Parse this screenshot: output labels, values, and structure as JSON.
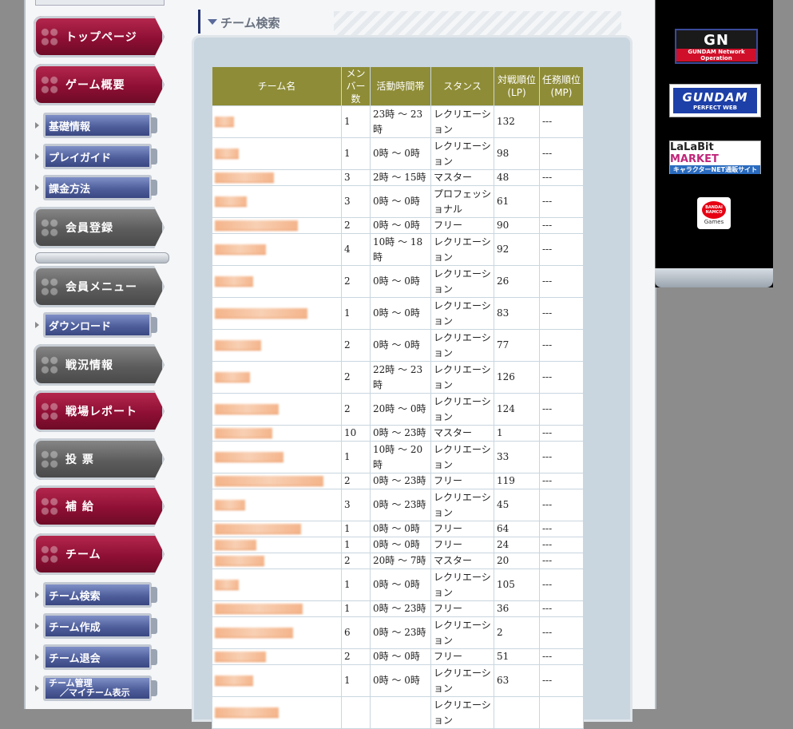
{
  "sidebar": {
    "main_items": [
      {
        "label": "トップページ",
        "style": "red"
      },
      {
        "label": "ゲーム概要",
        "style": "red"
      },
      {
        "label": "会員登録",
        "style": "gray"
      },
      {
        "label": "会員メニュー",
        "style": "gray"
      },
      {
        "label": "戦況情報",
        "style": "gray"
      },
      {
        "label": "戦場レポート",
        "style": "red"
      },
      {
        "label": "投 票",
        "style": "gray"
      },
      {
        "label": "補 給",
        "style": "red"
      },
      {
        "label": "チーム",
        "style": "red"
      }
    ],
    "sub_items": {
      "game_overview": [
        "基礎情報",
        "プレイガイド",
        "課金方法"
      ],
      "member_menu": [
        "ダウンロード"
      ],
      "team": [
        "チーム検索",
        "チーム作成",
        "チーム退会"
      ],
      "team_manage_line1": "チーム管理",
      "team_manage_line2": "／マイチーム表示"
    }
  },
  "header": {
    "title": "チーム検索"
  },
  "table": {
    "columns": {
      "name": "チーム名",
      "members": "メンバー数",
      "active_time": "活動時間帯",
      "stance": "スタンス",
      "lp_line1": "対戦順位",
      "lp_line2": "(LP)",
      "mp_line1": "任務順位",
      "mp_line2": "(MP)"
    },
    "rows": [
      {
        "members": "1",
        "time": "23時 〜 23時",
        "stance": "レクリエーション",
        "lp": "132",
        "mp": "---"
      },
      {
        "members": "1",
        "time": "0時 〜 0時",
        "stance": "レクリエーション",
        "lp": "98",
        "mp": "---"
      },
      {
        "members": "3",
        "time": "2時 〜 15時",
        "stance": "マスター",
        "lp": "48",
        "mp": "---"
      },
      {
        "members": "3",
        "time": "0時 〜 0時",
        "stance": "プロフェッショナル",
        "lp": "61",
        "mp": "---"
      },
      {
        "members": "2",
        "time": "0時 〜 0時",
        "stance": "フリー",
        "lp": "90",
        "mp": "---"
      },
      {
        "members": "4",
        "time": "10時 〜 18時",
        "stance": "レクリエーション",
        "lp": "92",
        "mp": "---"
      },
      {
        "members": "2",
        "time": "0時 〜 0時",
        "stance": "レクリエーション",
        "lp": "26",
        "mp": "---"
      },
      {
        "members": "1",
        "time": "0時 〜 0時",
        "stance": "レクリエーション",
        "lp": "83",
        "mp": "---"
      },
      {
        "members": "2",
        "time": "0時 〜 0時",
        "stance": "レクリエーション",
        "lp": "77",
        "mp": "---"
      },
      {
        "members": "2",
        "time": "22時 〜 23時",
        "stance": "レクリエーション",
        "lp": "126",
        "mp": "---"
      },
      {
        "members": "2",
        "time": "20時 〜 0時",
        "stance": "レクリエーション",
        "lp": "124",
        "mp": "---"
      },
      {
        "members": "10",
        "time": "0時 〜 23時",
        "stance": "マスター",
        "lp": "1",
        "mp": "---"
      },
      {
        "members": "1",
        "time": "10時 〜 20時",
        "stance": "レクリエーション",
        "lp": "33",
        "mp": "---"
      },
      {
        "members": "2",
        "time": "0時 〜 23時",
        "stance": "フリー",
        "lp": "119",
        "mp": "---"
      },
      {
        "members": "3",
        "time": "0時 〜 23時",
        "stance": "レクリエーション",
        "lp": "45",
        "mp": "---"
      },
      {
        "members": "1",
        "time": "0時 〜 0時",
        "stance": "フリー",
        "lp": "64",
        "mp": "---"
      },
      {
        "members": "1",
        "time": "0時 〜 0時",
        "stance": "フリー",
        "lp": "24",
        "mp": "---"
      },
      {
        "members": "2",
        "time": "20時 〜 7時",
        "stance": "マスター",
        "lp": "20",
        "mp": "---"
      },
      {
        "members": "1",
        "time": "0時 〜 0時",
        "stance": "レクリエーション",
        "lp": "105",
        "mp": "---"
      },
      {
        "members": "1",
        "time": "0時 〜 23時",
        "stance": "フリー",
        "lp": "36",
        "mp": "---"
      },
      {
        "members": "6",
        "time": "0時 〜 23時",
        "stance": "レクリエーション",
        "lp": "2",
        "mp": "---"
      },
      {
        "members": "2",
        "time": "0時 〜 0時",
        "stance": "フリー",
        "lp": "51",
        "mp": "---"
      },
      {
        "members": "1",
        "time": "0時 〜 0時",
        "stance": "レクリエーション",
        "lp": "63",
        "mp": "---"
      },
      {
        "members": "",
        "time": "",
        "stance": "レクリエーション",
        "lp": "",
        "mp": ""
      }
    ]
  },
  "banners": {
    "gn_main": "GN",
    "gn_sub": "GUNDAM Network Operation",
    "gundam_main": "GUNDAM",
    "gundam_sub": "PERFECT WEB",
    "lalabit_main_a": "LaLaBit ",
    "lalabit_main_b": "MARKET",
    "lalabit_sub": "キャラクターNET通販サイト",
    "bandai_logo": "BANDAI NAMCO",
    "bandai_sub": "Games"
  },
  "colors": {
    "nav_red": "#8e0f34",
    "nav_gray": "#5c5c5c",
    "nav_sub_blue": "#4f5f9c",
    "table_header": "#8e8c36",
    "content_panel": "#c9d6df",
    "page_bg": "#8c8c8c"
  }
}
